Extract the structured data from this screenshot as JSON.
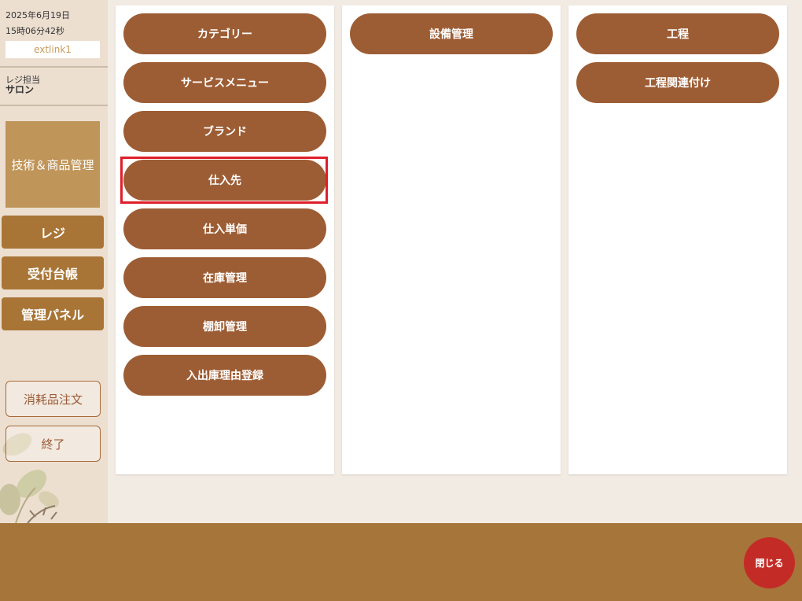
{
  "sidebar": {
    "date": "2025年6月19日",
    "time": "15時06分42秒",
    "link": "extlink1",
    "role_label": "レジ担当",
    "role_name": "サロン",
    "active_item": "技術＆商品管理",
    "nav": [
      "レジ",
      "受付台帳",
      "管理パネル"
    ],
    "secondary": [
      "消耗品注文",
      "終了"
    ]
  },
  "panels": [
    {
      "buttons": [
        "カテゴリー",
        "サービスメニュー",
        "ブランド",
        "仕入先",
        "仕入単価",
        "在庫管理",
        "棚卸管理",
        "入出庫理由登録"
      ]
    },
    {
      "buttons": [
        "設備管理"
      ]
    },
    {
      "buttons": [
        "工程",
        "工程関連付け"
      ]
    }
  ],
  "highlighted_item": "仕入先",
  "footer": {
    "close_label": "閉じる"
  },
  "colors": {
    "menu_button": "#9d5d34",
    "sidebar_active": "#c0955a",
    "sidebar_nav": "#a87536",
    "footer": "#a6753a",
    "close_button": "#c32c26",
    "highlight_border": "#e01f2a"
  }
}
